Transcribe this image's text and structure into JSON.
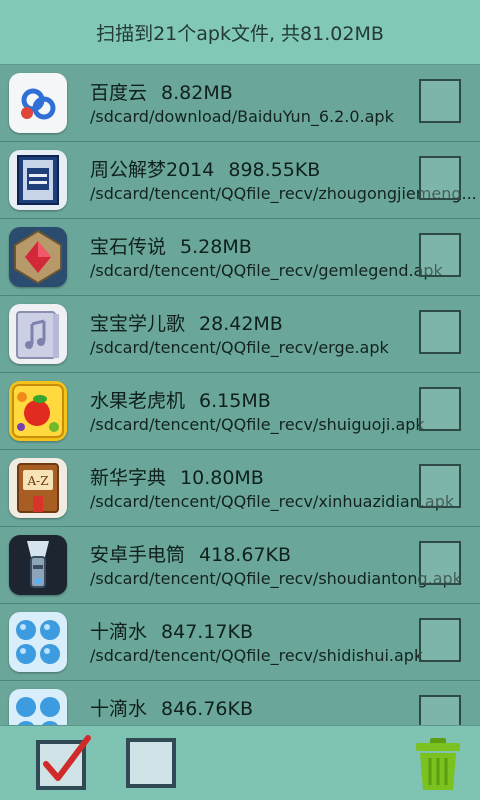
{
  "header": {
    "summary": "扫描到21个apk文件, 共81.02MB"
  },
  "apk_list": [
    {
      "name": "百度云",
      "size": "8.82MB",
      "path": "/sdcard/download/BaiduYun_6.2.0.apk",
      "icon": "baidu-cloud-icon",
      "checked": false
    },
    {
      "name": "周公解梦2014",
      "size": "898.55KB",
      "path": "/sdcard/tencent/QQfile_recv/zhougongjiemeng...",
      "icon": "dream-book-icon",
      "checked": false
    },
    {
      "name": "宝石传说",
      "size": "5.28MB",
      "path": "/sdcard/tencent/QQfile_recv/gemlegend.apk",
      "icon": "gem-icon",
      "checked": false
    },
    {
      "name": "宝宝学儿歌",
      "size": "28.42MB",
      "path": "/sdcard/tencent/QQfile_recv/erge.apk",
      "icon": "music-book-icon",
      "checked": false
    },
    {
      "name": "水果老虎机",
      "size": "6.15MB",
      "path": "/sdcard/tencent/QQfile_recv/shuiguoji.apk",
      "icon": "fruit-slot-icon",
      "checked": false
    },
    {
      "name": "新华字典",
      "size": "10.80MB",
      "path": "/sdcard/tencent/QQfile_recv/xinhuazidian.apk",
      "icon": "dictionary-icon",
      "checked": false
    },
    {
      "name": "安卓手电筒",
      "size": "418.67KB",
      "path": "/sdcard/tencent/QQfile_recv/shoudiantong.apk",
      "icon": "flashlight-icon",
      "checked": false
    },
    {
      "name": "十滴水",
      "size": "847.17KB",
      "path": "/sdcard/tencent/QQfile_recv/shidishui.apk",
      "icon": "water-drops-icon",
      "checked": false
    },
    {
      "name": "十滴水",
      "size": "846.76KB",
      "path": "",
      "icon": "water-drops-icon",
      "checked": false
    }
  ],
  "footer": {
    "select_all_icon": "checked-checkbox-icon",
    "deselect_all_icon": "empty-checkbox-icon",
    "delete_icon": "trash-icon"
  },
  "colors": {
    "header_bg": "#82c8b7",
    "list_bg": "#6aa79a",
    "footer_bg": "#7fc3b3",
    "check_mark": "#d12a2a",
    "trash": "#7bc11f"
  }
}
